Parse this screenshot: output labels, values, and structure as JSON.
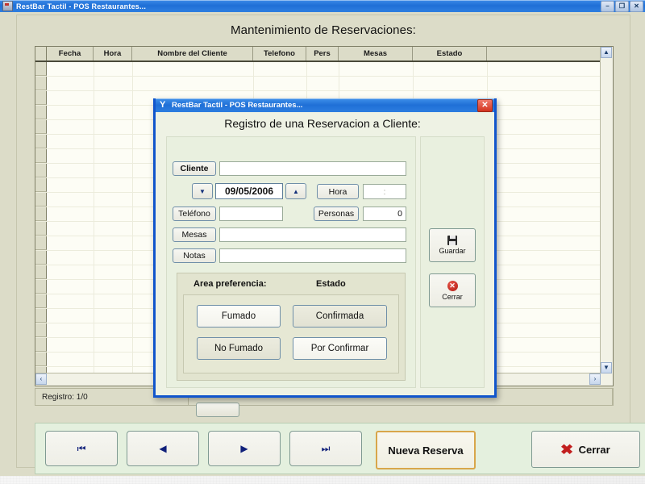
{
  "window": {
    "title": "RestBar Tactil - POS Restaurantes...",
    "app_icon": "app-icon",
    "minimize": "–",
    "maximize": "❐",
    "close": "✕"
  },
  "main": {
    "heading": "Mantenimiento de Reservaciones:",
    "grid": {
      "columns": [
        "Fecha",
        "Hora",
        "Nombre del Cliente",
        "Telefono",
        "Pers",
        "Mesas",
        "Estado"
      ],
      "rows": []
    },
    "status": {
      "record": "Registro: 1/0"
    },
    "scroll": {
      "up": "▲",
      "down": "▼",
      "left": "‹",
      "right": "›"
    }
  },
  "toolbar": {
    "first_label": "⏮",
    "prev_label": "◀",
    "next_label": "▶",
    "last_label": "⏭",
    "nueva_reserva": "Nueva Reserva",
    "cerrar": "Cerrar",
    "cerrar_icon": "✖"
  },
  "dialog": {
    "titlebar": "RestBar Tactil - POS Restaurantes...",
    "title_icon": "cocktail-icon",
    "close_label": "✕",
    "heading": "Registro de una Reservacion a Cliente:",
    "fields": {
      "cliente_label": "Cliente",
      "cliente_value": "",
      "fecha_value": "09/05/2006",
      "fecha_down": "▼",
      "fecha_up": "▲",
      "hora_label": "Hora",
      "hora_value": ":",
      "telefono_label": "Teléfono",
      "telefono_value": "",
      "personas_label": "Personas",
      "personas_value": "0",
      "mesas_label": "Mesas",
      "mesas_value": "",
      "notas_label": "Notas",
      "notas_value": ""
    },
    "group": {
      "area_label": "Area preferencia:",
      "estado_label": "Estado",
      "fumado": "Fumado",
      "no_fumado": "No Fumado",
      "confirmada": "Confirmada",
      "por_confirmar": "Por Confirmar"
    },
    "actions": {
      "guardar": "Guardar",
      "guardar_icon": "save-floppy-icon",
      "cerrar": "Cerrar",
      "cerrar_icon": "✕"
    }
  },
  "colors": {
    "titlebar_blue": "#1f6fd6",
    "dialog_border": "#1155cc",
    "panel_beige": "#dcdcc8",
    "dialog_body": "#eef2e4",
    "bottom_bar": "#e4f0de",
    "focus_gold": "#d8a64a",
    "close_red": "#c21f1f"
  }
}
